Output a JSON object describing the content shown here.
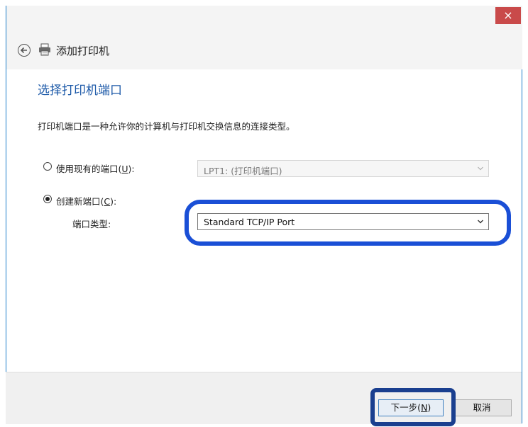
{
  "titlebar": {
    "close_label": "×"
  },
  "header": {
    "title": "添加打印机"
  },
  "page": {
    "title": "选择打印机端口",
    "description": "打印机端口是一种允许你的计算机与打印机交换信息的连接类型。"
  },
  "options": {
    "use_existing": {
      "label_prefix": "使用现有的端口(",
      "mnemonic": "U",
      "label_suffix": "):",
      "selected": false
    },
    "existing_port_value": "LPT1: (打印机端口)",
    "create_new": {
      "label_prefix": "创建新端口(",
      "mnemonic": "C",
      "label_suffix": "):",
      "selected": true
    },
    "port_type_label": "端口类型:",
    "port_type_value": "Standard TCP/IP Port"
  },
  "footer": {
    "next_prefix": "下一步(",
    "next_mnemonic": "N",
    "next_suffix": ")",
    "cancel_label": "取消"
  },
  "colors": {
    "accent": "#1a4fd6",
    "title_blue": "#1c59a8",
    "close_red": "#c94a4a"
  }
}
